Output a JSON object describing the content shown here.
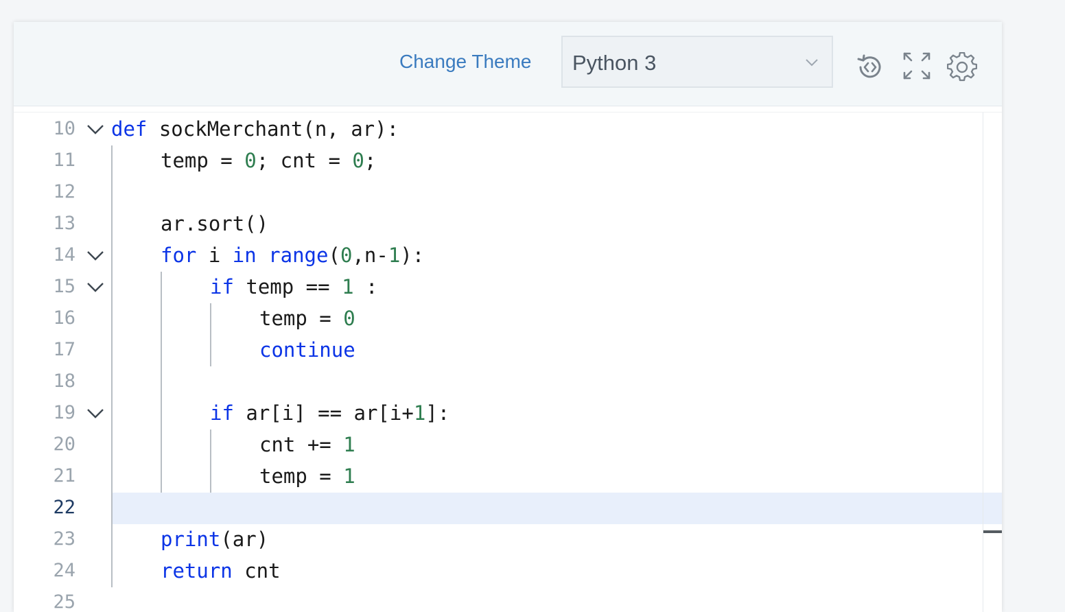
{
  "toolbar": {
    "change_theme_label": "Change Theme",
    "language_selected": "Python 3",
    "icons": [
      "reset-history-icon",
      "fullscreen-icon",
      "gear-icon"
    ]
  },
  "editor": {
    "active_line": 22,
    "lines": [
      {
        "n": "10",
        "fold": true,
        "indent": 0,
        "tokens": [
          [
            "kw",
            "def"
          ],
          [
            "t",
            " sockMerchant(n, ar):"
          ]
        ]
      },
      {
        "n": "11",
        "fold": false,
        "indent": 1,
        "tokens": [
          [
            "t",
            "temp = "
          ],
          [
            "num",
            "0"
          ],
          [
            "t",
            "; cnt = "
          ],
          [
            "num",
            "0"
          ],
          [
            "t",
            ";"
          ]
        ]
      },
      {
        "n": "12",
        "fold": false,
        "indent": 1,
        "tokens": []
      },
      {
        "n": "13",
        "fold": false,
        "indent": 1,
        "tokens": [
          [
            "t",
            "ar.sort()"
          ]
        ]
      },
      {
        "n": "14",
        "fold": true,
        "indent": 1,
        "tokens": [
          [
            "kw",
            "for"
          ],
          [
            "t",
            " i "
          ],
          [
            "kw",
            "in"
          ],
          [
            "t",
            " "
          ],
          [
            "kw",
            "range"
          ],
          [
            "t",
            "("
          ],
          [
            "num",
            "0"
          ],
          [
            "t",
            ",n-"
          ],
          [
            "num",
            "1"
          ],
          [
            "t",
            "):"
          ]
        ]
      },
      {
        "n": "15",
        "fold": true,
        "indent": 2,
        "tokens": [
          [
            "kw",
            "if"
          ],
          [
            "t",
            " temp == "
          ],
          [
            "num",
            "1"
          ],
          [
            "t",
            " :"
          ]
        ]
      },
      {
        "n": "16",
        "fold": false,
        "indent": 3,
        "tokens": [
          [
            "t",
            "temp = "
          ],
          [
            "num",
            "0"
          ]
        ]
      },
      {
        "n": "17",
        "fold": false,
        "indent": 3,
        "tokens": [
          [
            "kw",
            "continue"
          ]
        ]
      },
      {
        "n": "18",
        "fold": false,
        "indent": 2,
        "tokens": []
      },
      {
        "n": "19",
        "fold": true,
        "indent": 2,
        "tokens": [
          [
            "kw",
            "if"
          ],
          [
            "t",
            " ar[i] == ar[i+"
          ],
          [
            "num",
            "1"
          ],
          [
            "t",
            "]:"
          ]
        ]
      },
      {
        "n": "20",
        "fold": false,
        "indent": 3,
        "tokens": [
          [
            "t",
            "cnt += "
          ],
          [
            "num",
            "1"
          ]
        ]
      },
      {
        "n": "21",
        "fold": false,
        "indent": 3,
        "tokens": [
          [
            "t",
            "temp = "
          ],
          [
            "num",
            "1"
          ]
        ]
      },
      {
        "n": "22",
        "fold": false,
        "indent": 1,
        "tokens": []
      },
      {
        "n": "23",
        "fold": false,
        "indent": 1,
        "tokens": [
          [
            "kw",
            "print"
          ],
          [
            "t",
            "(ar)"
          ]
        ]
      },
      {
        "n": "24",
        "fold": false,
        "indent": 1,
        "tokens": [
          [
            "kw",
            "return"
          ],
          [
            "t",
            " cnt"
          ]
        ]
      },
      {
        "n": "25",
        "fold": false,
        "indent": 0,
        "tokens": []
      }
    ]
  },
  "colors": {
    "keyword": "#0b34e6",
    "number": "#2e7d4f",
    "link": "#3a7bbf",
    "active_line_bg": "#e8effb"
  }
}
